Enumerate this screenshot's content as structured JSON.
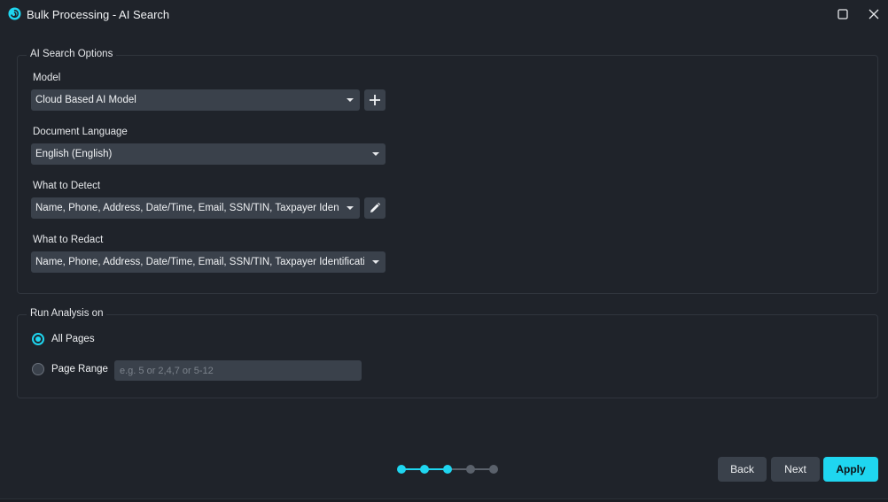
{
  "window": {
    "title": "Bulk Processing - AI Search",
    "colors": {
      "background": "#1f232a",
      "accent": "#1fd6f0",
      "control": "#3a414b"
    }
  },
  "ai_search_options": {
    "legend": "AI Search Options",
    "model": {
      "label": "Model",
      "value": "Cloud Based AI Model"
    },
    "document_language": {
      "label": "Document Language",
      "value": "English (English)"
    },
    "what_to_detect": {
      "label": "What to Detect",
      "value": "Name, Phone, Address, Date/Time, Email, SSN/TIN, Taxpayer Identification"
    },
    "what_to_redact": {
      "label": "What to Redact",
      "value": "Name, Phone, Address, Date/Time, Email, SSN/TIN, Taxpayer Identification"
    }
  },
  "run_analysis": {
    "legend": "Run Analysis on",
    "all_pages": {
      "label": "All Pages",
      "checked": true
    },
    "page_range": {
      "label": "Page Range",
      "checked": false,
      "placeholder": "e.g. 5 or 2,4,7 or 5-12",
      "value": ""
    }
  },
  "stepper": {
    "total_steps": 5,
    "current_step": 3
  },
  "footer": {
    "back_label": "Back",
    "next_label": "Next",
    "apply_label": "Apply"
  },
  "icons": {
    "app": "ai-swirl-icon",
    "maximize": "maximize-icon",
    "close": "close-icon",
    "add_model": "plus-icon",
    "edit_detect": "pencil-icon"
  }
}
